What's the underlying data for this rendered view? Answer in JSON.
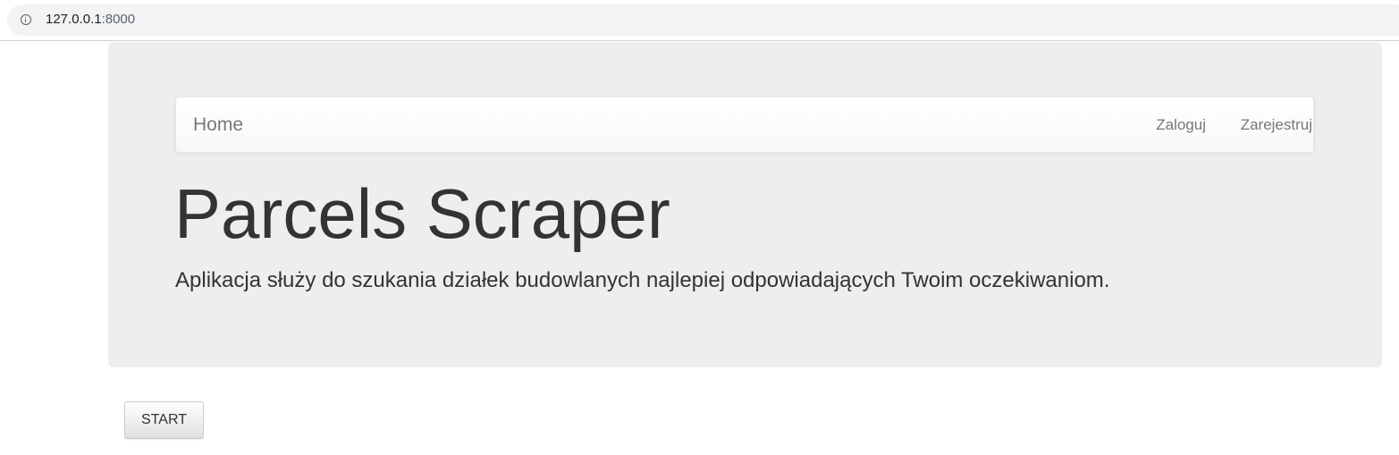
{
  "browser": {
    "url_host": "127.0.0.1",
    "url_port": ":8000"
  },
  "navbar": {
    "brand": "Home",
    "links": [
      {
        "label": "Zaloguj"
      },
      {
        "label": "Zarejestruj"
      }
    ]
  },
  "jumbotron": {
    "title": "Parcels Scraper",
    "lead": "Aplikacja służy do szukania działek budowlanych najlepiej odpowiadających Twoim oczekiwaniom."
  },
  "actions": {
    "start_label": "START"
  },
  "icons": {
    "site_info": "info-icon"
  }
}
